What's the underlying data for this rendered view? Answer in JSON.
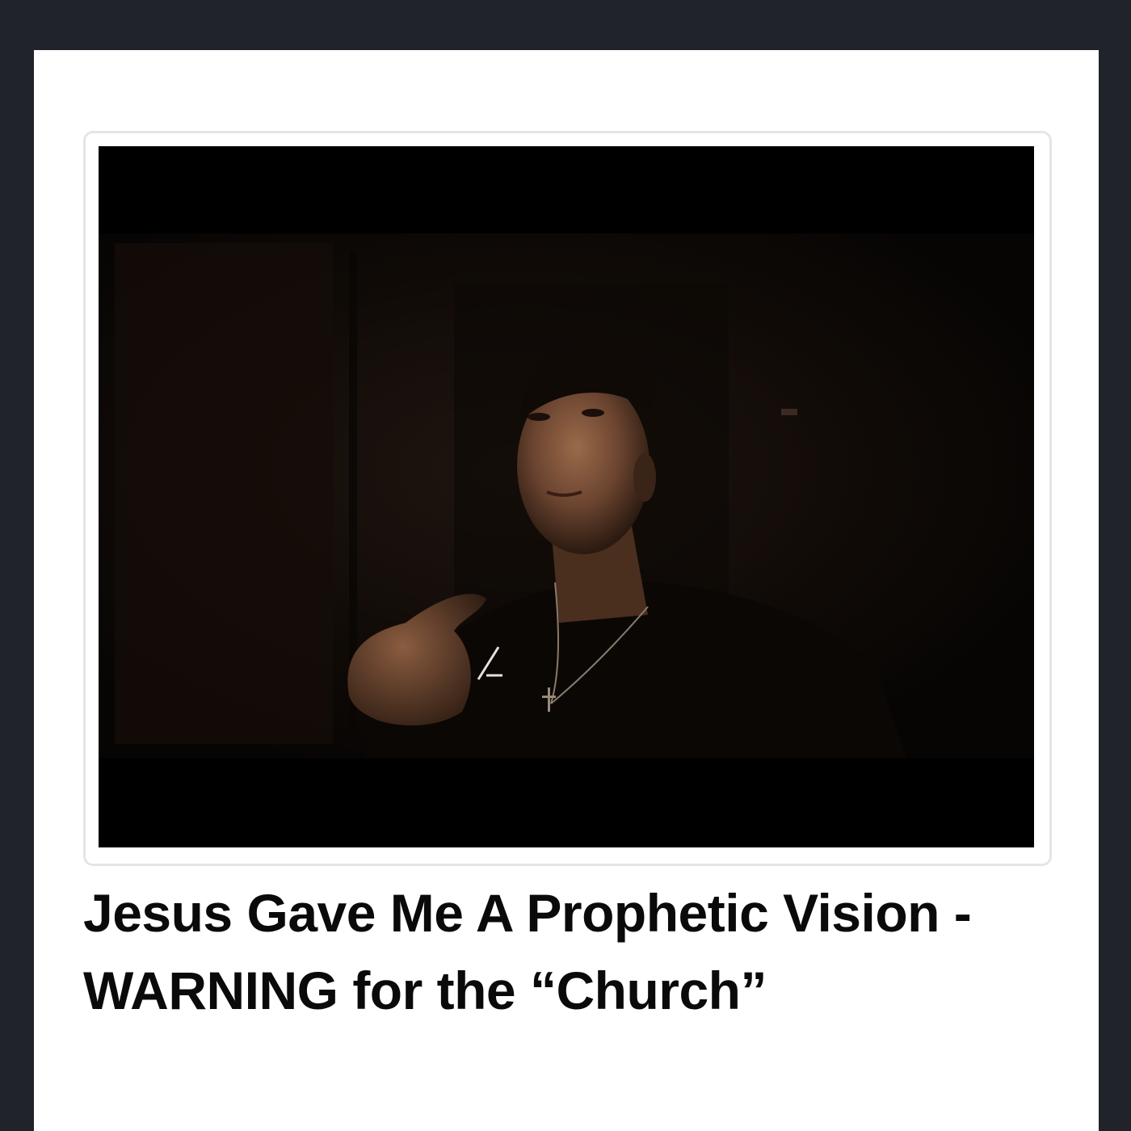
{
  "video": {
    "title": "Jesus Gave Me A Prophetic Vision - WARNING for the “Church”",
    "thumbnail": "man-with-cross-necklace-in-dark-room"
  },
  "colors": {
    "outer_background": "#202329",
    "page_background": "#ffffff",
    "card_border": "#e4e5ea",
    "title_text": "#0a0a0a"
  }
}
